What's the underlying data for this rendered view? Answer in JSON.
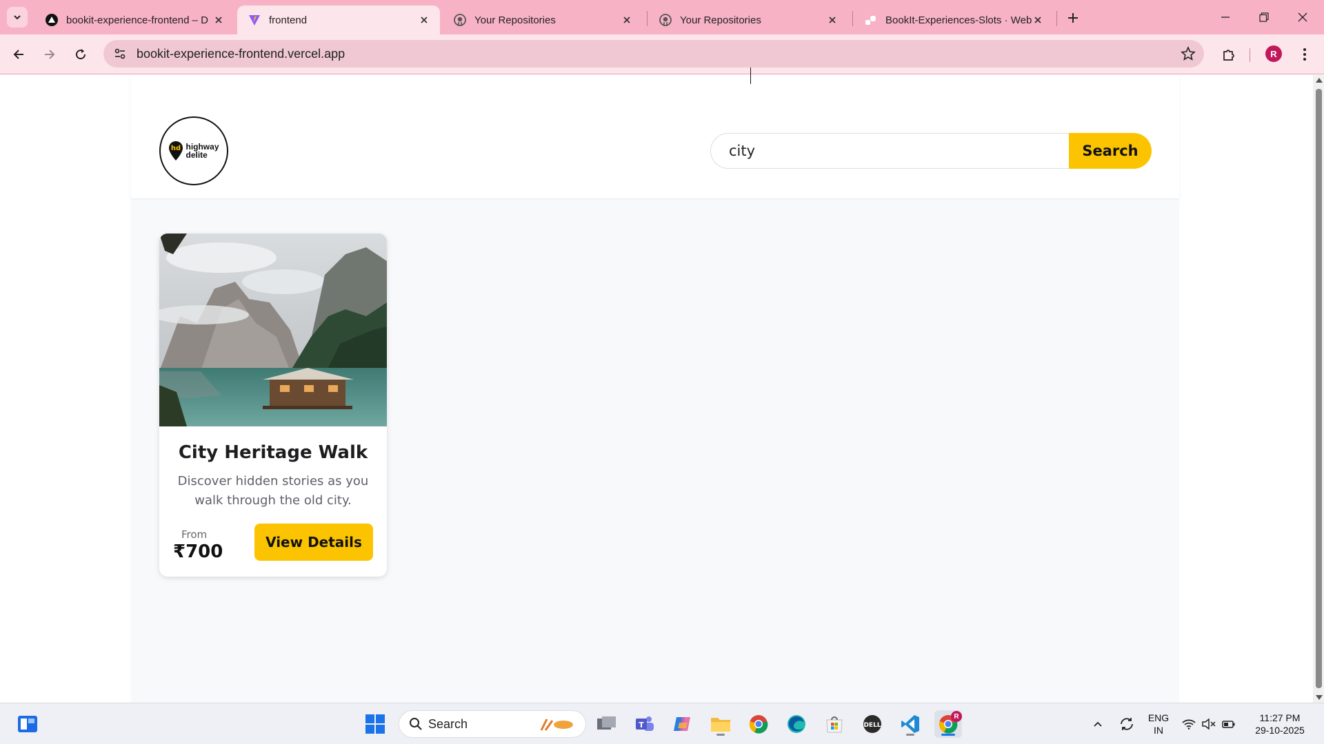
{
  "browser": {
    "tabs": [
      {
        "title": "bookit-experience-frontend – D",
        "icon": "vercel-triangle-icon",
        "active": false
      },
      {
        "title": "frontend",
        "icon": "vite-icon",
        "active": true
      },
      {
        "title": "Your Repositories",
        "icon": "github-icon",
        "active": false
      },
      {
        "title": "Your Repositories",
        "icon": "github-icon",
        "active": false
      },
      {
        "title": "BookIt-Experiences-Slots · Web",
        "icon": "render-icon",
        "active": false
      }
    ],
    "url": "bookit-experience-frontend.vercel.app",
    "profile_initial": "R",
    "theme_color": "#f7b2c6"
  },
  "header": {
    "logo_line1": "highway",
    "logo_line2": "delite",
    "logo_badge": "hd",
    "search_value": "city",
    "search_button": "Search"
  },
  "results": [
    {
      "title": "City Heritage Walk",
      "description": "Discover hidden stories as you walk through the old city.",
      "from_label": "From",
      "price": "₹700",
      "button": "View Details",
      "image": "mountain-lake-cabin-photo"
    }
  ],
  "accent_color": "#fcc400",
  "taskbar": {
    "search_label": "Search",
    "language": "ENG",
    "region": "IN",
    "time": "11:27 PM",
    "date": "29-10-2025",
    "chrome_badge": "R"
  }
}
